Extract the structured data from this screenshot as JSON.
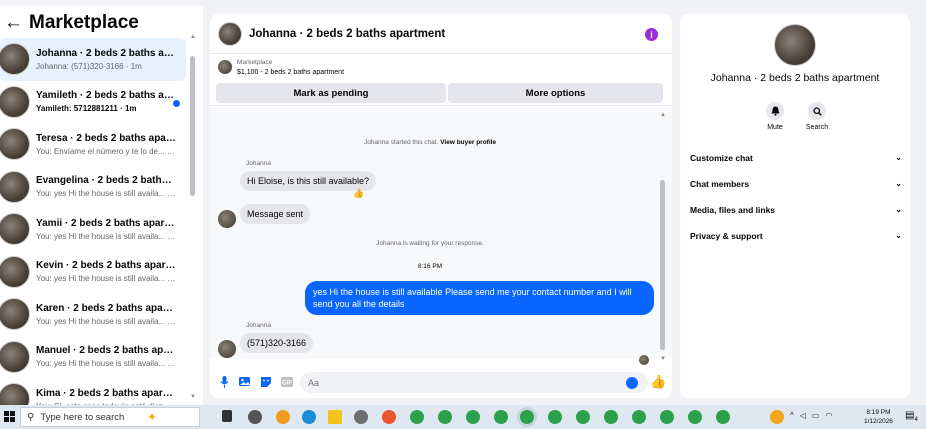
{
  "header": {
    "back_icon": "←",
    "title": "Marketplace"
  },
  "chats": [
    {
      "title": "Johanna · 2 beds 2 baths apart...",
      "preview": "Johanna: (571)320-3166 · 1m",
      "bold": false,
      "active": true,
      "unread": false
    },
    {
      "title": "Yamileth · 2 beds 2 baths apar...",
      "preview": "Yamileth: 5712881211 · 1m",
      "bold": true,
      "active": false,
      "unread": true
    },
    {
      "title": "Teresa · 2 beds 2 baths apartment",
      "preview": "You: Envíame el número y te lo de... · 2m",
      "bold": false,
      "active": false,
      "unread": false
    },
    {
      "title": "Evangelina · 2 beds 2 baths apa...",
      "preview": "You: yes Hi the house is still availa... · 2m",
      "bold": false,
      "active": false,
      "unread": false
    },
    {
      "title": "Yamii · 2 beds 2 baths apartment",
      "preview": "You: yes Hi the house is still availa... · 3m",
      "bold": false,
      "active": false,
      "unread": false
    },
    {
      "title": "Kevin · 2 beds 2 baths apartment",
      "preview": "You: yes Hi the house is still availa... · 3m",
      "bold": false,
      "active": false,
      "unread": false
    },
    {
      "title": "Karen · 2 beds 2 baths apartment",
      "preview": "You: yes Hi the house is still availa... · 3m",
      "bold": false,
      "active": false,
      "unread": false
    },
    {
      "title": "Manuel · 2 beds 2 baths apartm...",
      "preview": "You: yes Hi the house is still availa... · 3m",
      "bold": false,
      "active": false,
      "unread": false
    },
    {
      "title": "Kima · 2 beds 2 baths apartment",
      "preview": "You: Sí, esta casa todavía está disp... · 3m",
      "bold": false,
      "active": false,
      "unread": false
    }
  ],
  "conversation": {
    "title": "Johanna · 2 beds 2 baths apartment",
    "info_icon": "i",
    "listing_category": "Marketplace",
    "listing_price": "$1,100 - 2 beds 2 baths apartment",
    "pending_button": "Mark as pending",
    "more_button": "More options",
    "started_text": "Johanna started this chat.",
    "view_profile": "View buyer profile",
    "sender_name_1": "Johanna",
    "msg_1": "Hi Eloise, is this still available?",
    "reaction": "👍",
    "msg_2": "Message sent",
    "waiting_text": "Johanna is waiting for your response.",
    "time_sep": "8:16 PM",
    "msg_out": "yes Hi the house is still available Please send me your contact number and I will send you all the details",
    "sender_name_2": "Johanna",
    "msg_3": "(571)320-3166",
    "composer_placeholder": "Aa",
    "like_icon": "👍"
  },
  "right_panel": {
    "name": "Johanna · 2 beds 2 baths apartment",
    "mute_label": "Mute",
    "search_label": "Search",
    "rows": [
      "Customize chat",
      "Chat members",
      "Media, files and links",
      "Privacy & support"
    ],
    "chevron": "⌄"
  },
  "taskbar": {
    "search_placeholder": "Type here to search",
    "time": "8:19 PM",
    "date": "1/12/2026",
    "notif_count": "4"
  },
  "colors": {
    "accent": "#0866ff",
    "info": "#9b2fd9"
  }
}
